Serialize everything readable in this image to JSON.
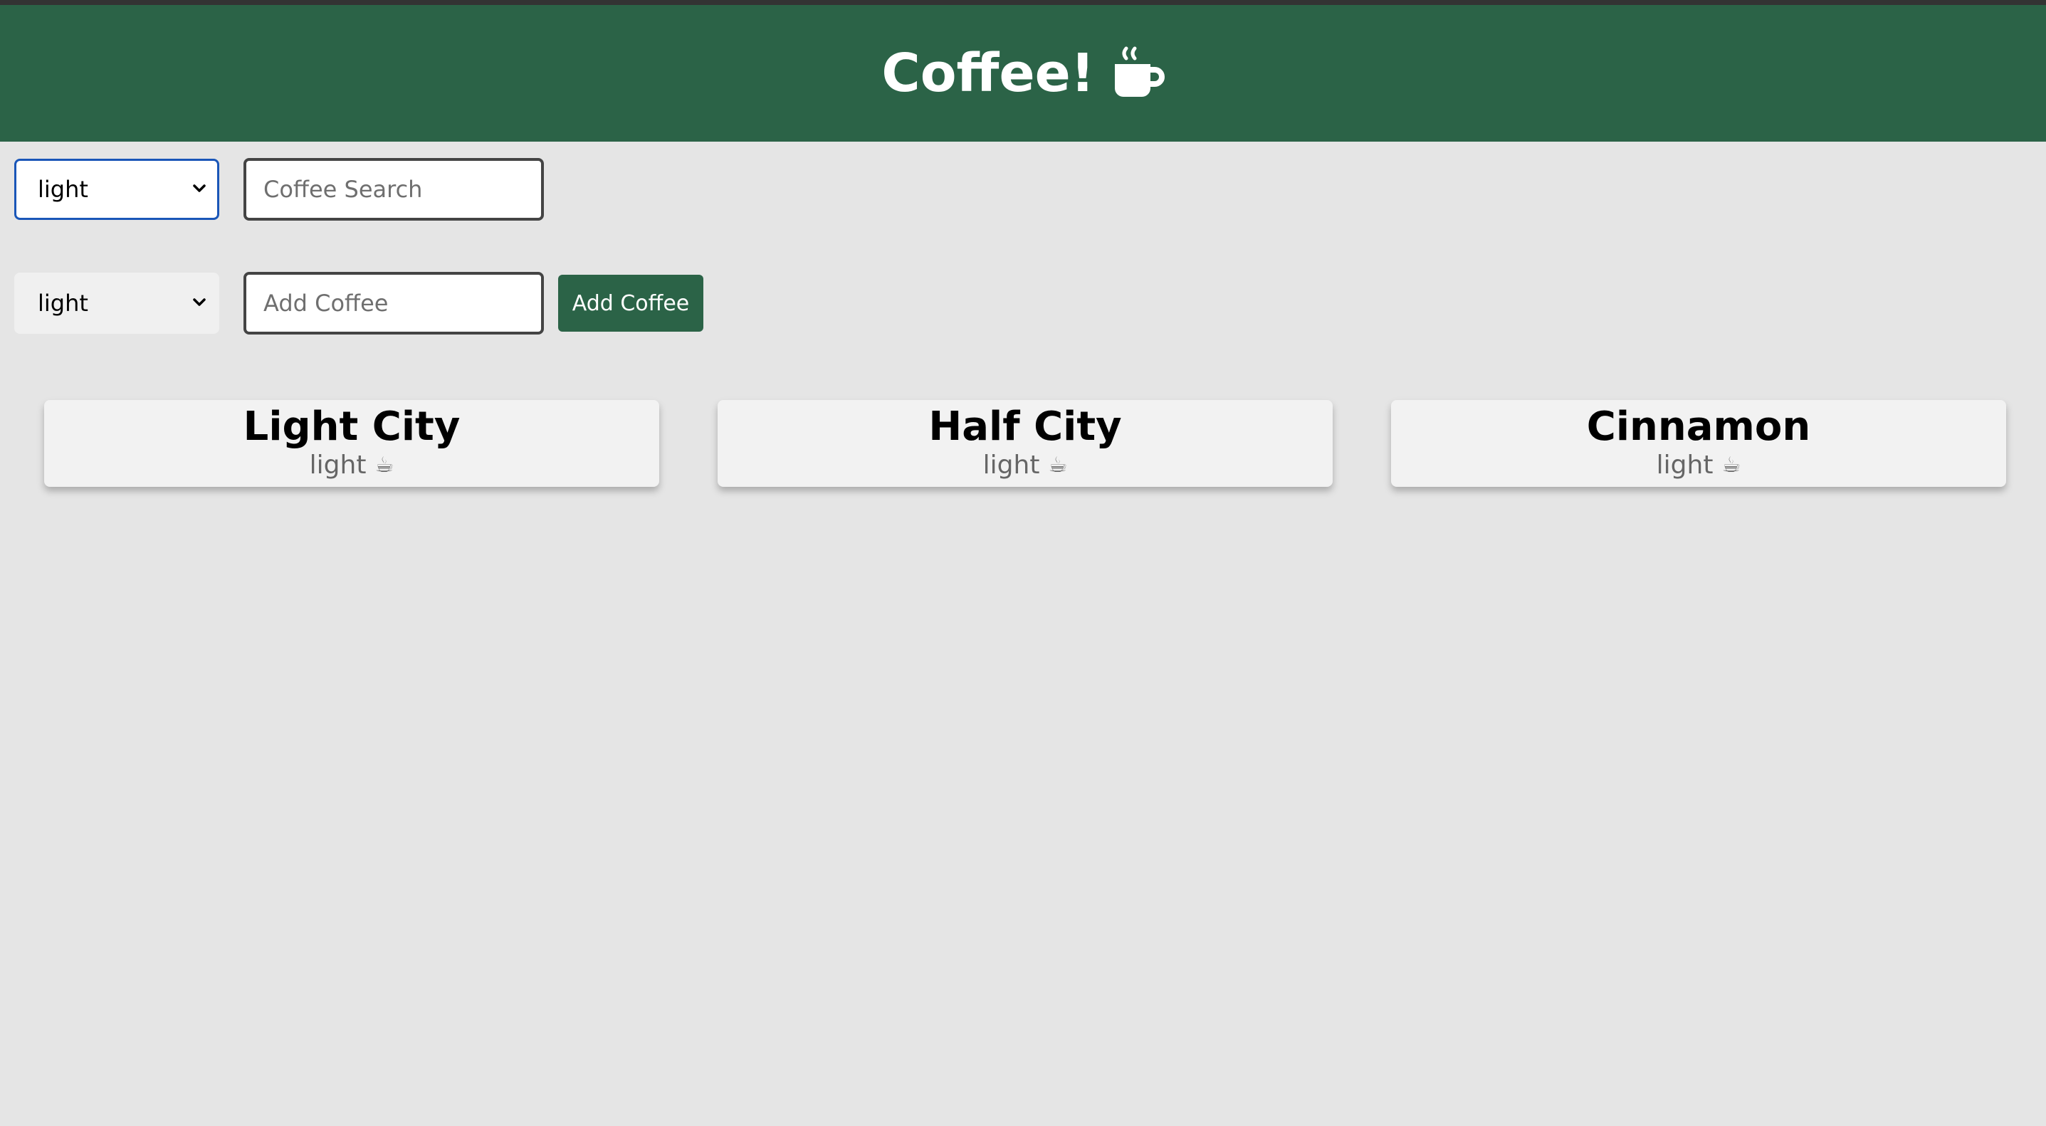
{
  "header": {
    "title": "Coffee!",
    "icon": "mug-hot-icon"
  },
  "search": {
    "roast_selected": "light",
    "input_placeholder": "Coffee Search",
    "input_value": ""
  },
  "add": {
    "roast_selected": "light",
    "input_placeholder": "Add Coffee",
    "input_value": "",
    "button_label": "Add Coffee"
  },
  "coffees": [
    {
      "name": "Light City",
      "roast": "light",
      "icon": "☕"
    },
    {
      "name": "Half City",
      "roast": "light",
      "icon": "☕"
    },
    {
      "name": "Cinnamon",
      "roast": "light",
      "icon": "☕"
    }
  ],
  "colors": {
    "brand_green": "#2b6347",
    "background": "#e5e5e5",
    "card": "#f2f2f2",
    "focus_blue": "#1a56b8"
  }
}
